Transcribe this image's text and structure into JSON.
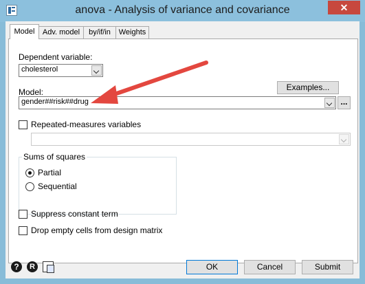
{
  "window": {
    "title": "anova - Analysis of variance and covariance",
    "close_glyph": "✕"
  },
  "tabs": [
    {
      "label": "Model",
      "active": true
    },
    {
      "label": "Adv. model",
      "active": false
    },
    {
      "label": "by/if/in",
      "active": false
    },
    {
      "label": "Weights",
      "active": false
    }
  ],
  "model_tab": {
    "dependent_variable_label": "Dependent variable:",
    "dependent_variable_value": "cholesterol",
    "model_label": "Model:",
    "examples_button": "Examples...",
    "model_value": "gender##risk##drug",
    "browse_button": "...",
    "repeated_measures_label": "Repeated-measures variables",
    "repeated_measures_checked": false,
    "repeated_measures_value": "",
    "sums_of_squares": {
      "label": "Sums of squares",
      "options": [
        {
          "label": "Partial",
          "selected": true
        },
        {
          "label": "Sequential",
          "selected": false
        }
      ]
    },
    "suppress_constant_label": "Suppress constant term",
    "suppress_constant_checked": false,
    "drop_empty_cells_label": "Drop empty cells from design matrix",
    "drop_empty_cells_checked": false
  },
  "footer": {
    "help_glyph": "?",
    "reset_glyph": "R",
    "ok_button": "OK",
    "cancel_button": "Cancel",
    "submit_button": "Submit"
  },
  "colors": {
    "annotation_arrow": "#e3473f",
    "title_bar": "#8cc0dd",
    "close_button": "#c7483e"
  },
  "icons": [
    "stata-app-icon",
    "close-icon",
    "chevron-down-icon",
    "help-icon",
    "reset-icon",
    "copy-command-icon",
    "annotation-arrow"
  ]
}
